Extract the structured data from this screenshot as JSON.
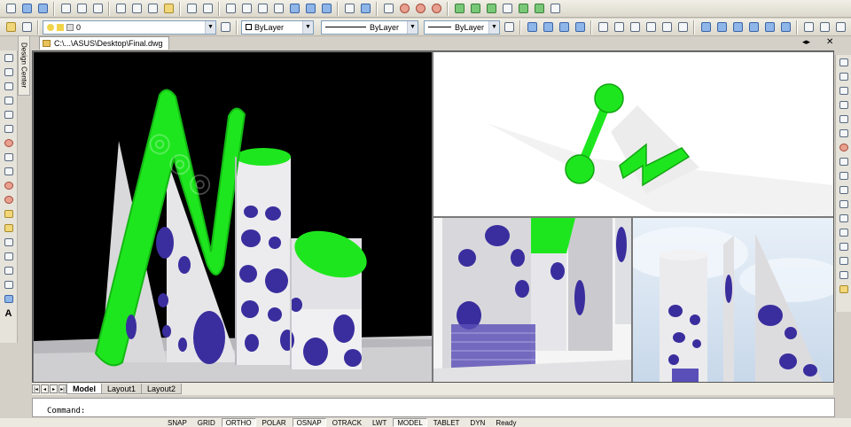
{
  "document": {
    "tab_title": "C:\\...\\ASUS\\Desktop\\Final.dwg"
  },
  "properties": {
    "layer_value": "0",
    "color_value": "ByLayer",
    "linetype_value": "ByLayer",
    "lineweight_value": "ByLayer"
  },
  "design_center": {
    "label": "Design Center"
  },
  "layout_tabs": [
    "Model",
    "Layout1",
    "Layout2"
  ],
  "command": {
    "prompt": "Command:"
  },
  "status_bar": {
    "toggles": [
      "SNAP",
      "GRID",
      "ORTHO",
      "POLAR",
      "OSNAP",
      "OTRACK",
      "LWT",
      "MODEL",
      "TABLET",
      "DYN"
    ],
    "active": [
      "ORTHO",
      "OSNAP",
      "MODEL"
    ],
    "status_text": "Ready"
  },
  "left_toolbar": {
    "text_tool_label": "A"
  },
  "colors": {
    "accent_green": "#1ee61e",
    "viewport_black": "#000000",
    "building_white": "#e8e8ea",
    "window_blue": "#3a2e9e"
  }
}
